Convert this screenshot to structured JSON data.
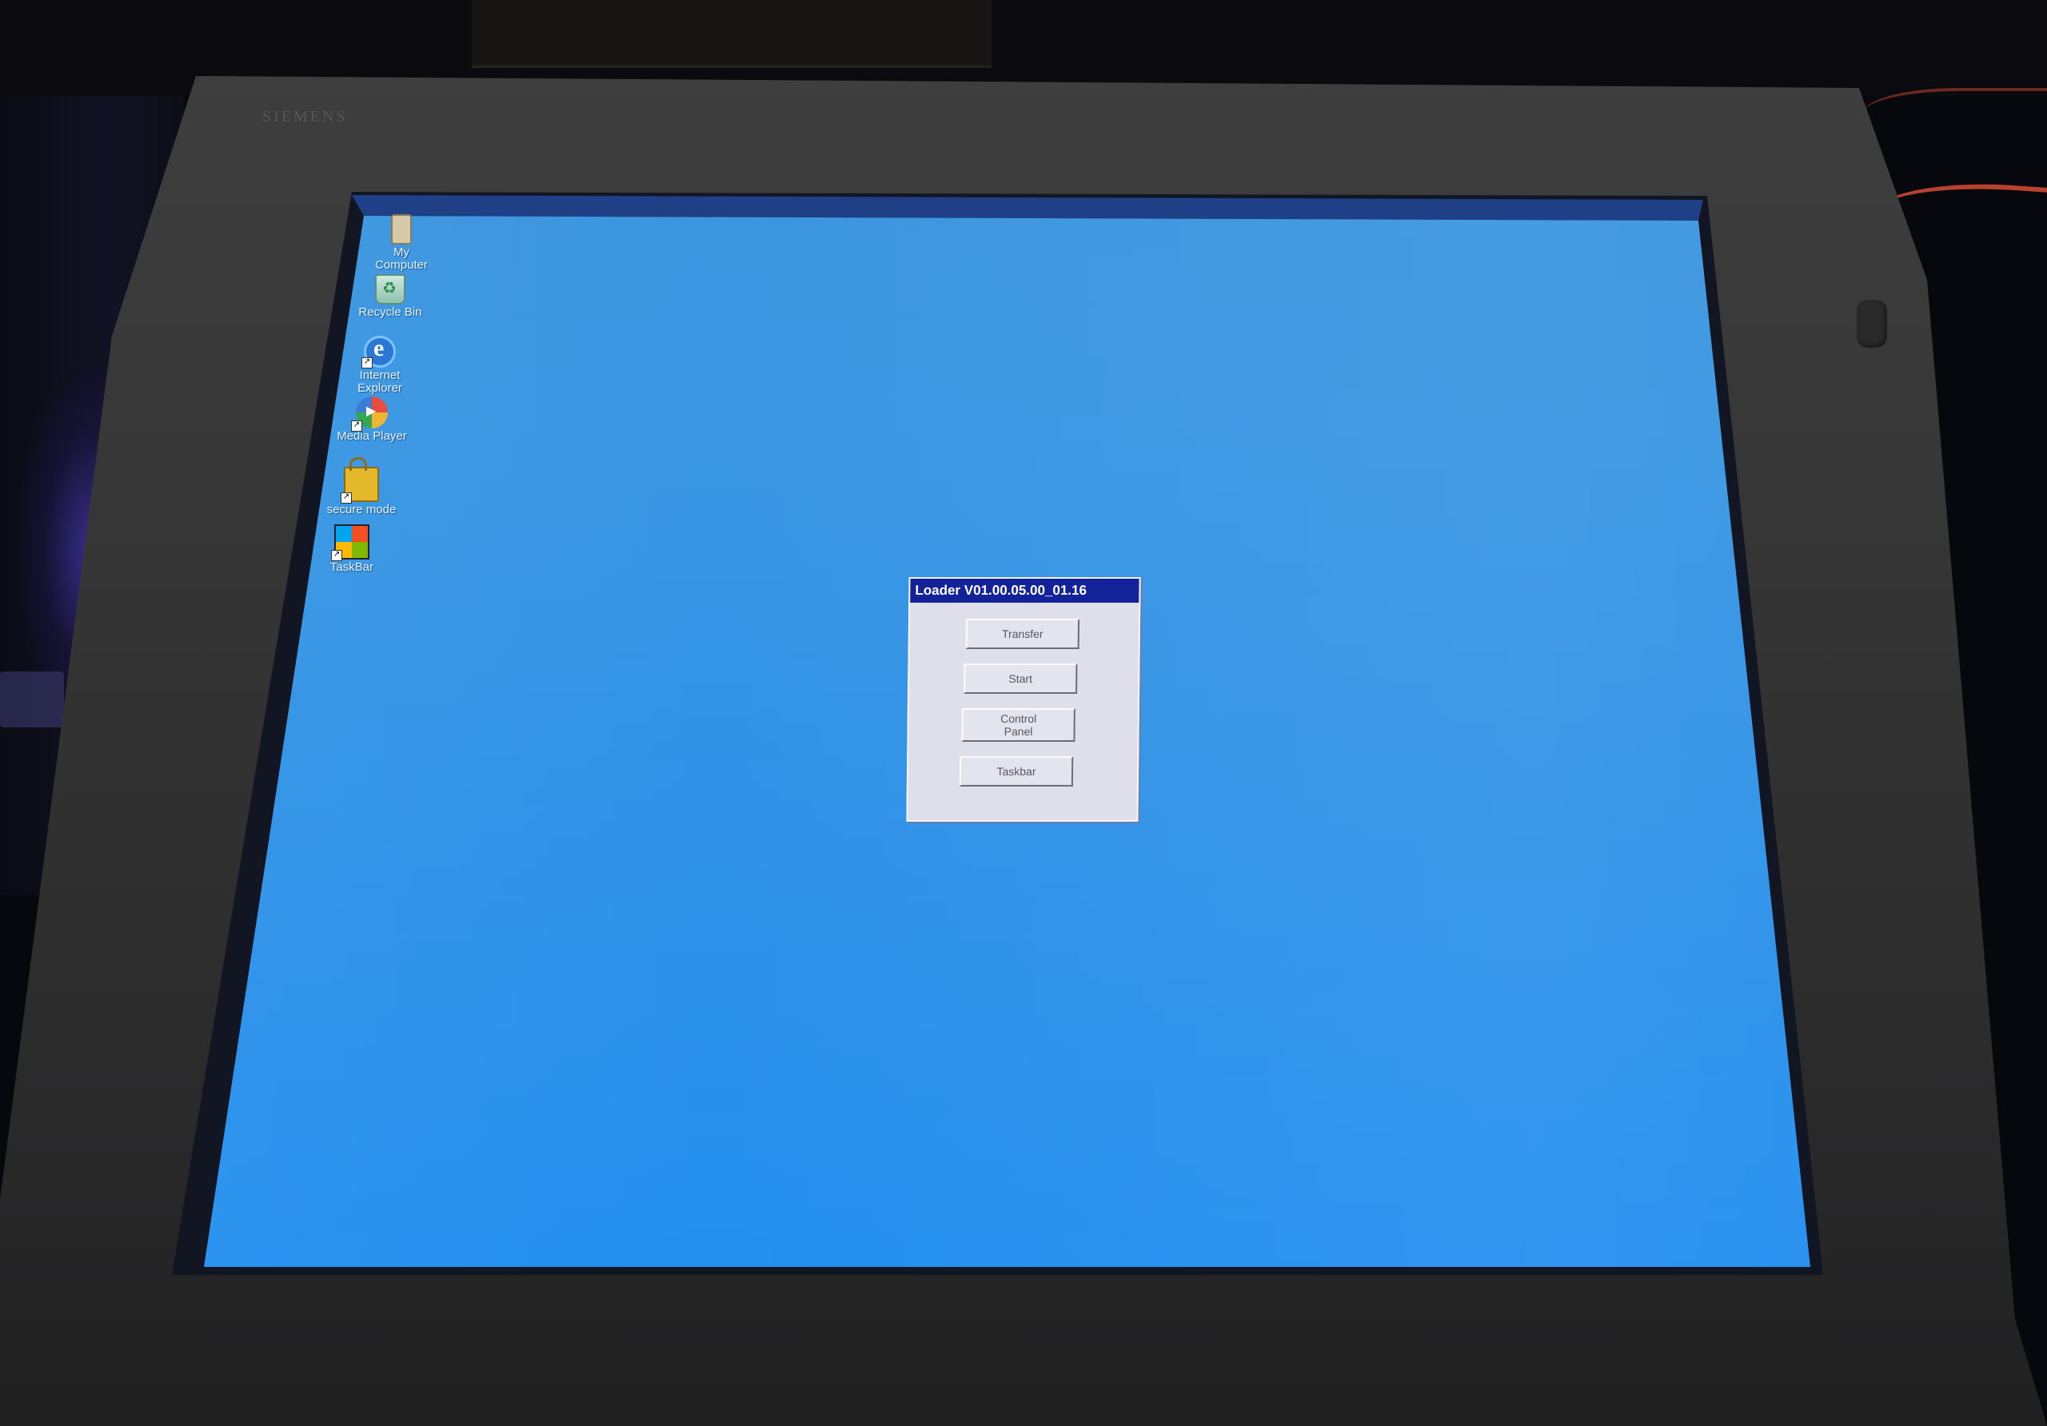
{
  "monitor": {
    "brand": "SIEMENS"
  },
  "desktop": {
    "icons": [
      {
        "name": "my-computer",
        "label": "My\nComputer",
        "icon": "computer-icon"
      },
      {
        "name": "recycle-bin",
        "label": "Recycle Bin",
        "icon": "recycle-bin-icon"
      },
      {
        "name": "internet-explorer",
        "label": "Internet\nExplorer",
        "icon": "internet-explorer-icon"
      },
      {
        "name": "media-player",
        "label": "Media Player",
        "icon": "media-player-icon"
      },
      {
        "name": "secure-mode",
        "label": "secure mode",
        "icon": "lock-icon"
      },
      {
        "name": "taskbar",
        "label": "TaskBar",
        "icon": "windows-flag-icon"
      }
    ],
    "background_color": "#2f92e8"
  },
  "loader_dialog": {
    "title": "Loader V01.00.05.00_01.16",
    "buttons": {
      "transfer": "Transfer",
      "start": "Start",
      "control_panel": "Control\nPanel",
      "taskbar": "Taskbar"
    },
    "title_color": "#14229a"
  }
}
